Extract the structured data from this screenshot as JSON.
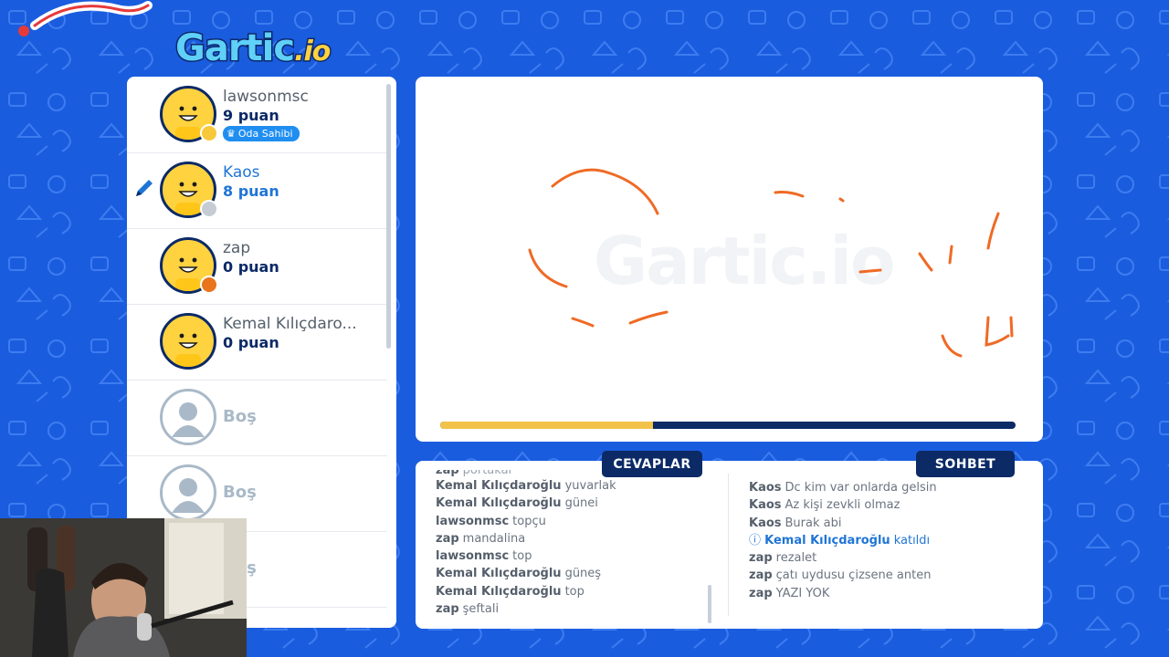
{
  "logo": {
    "text": "Gartic",
    "suffix": ".io"
  },
  "players": [
    {
      "name": "lawsonmsc",
      "score": "9 puan",
      "badge": "Oda Sahibi",
      "status_color": "#f7c83a",
      "active": false
    },
    {
      "name": "Kaos",
      "score": "8 puan",
      "status_color": "#c6ccd3",
      "active": true
    },
    {
      "name": "zap",
      "score": "0 puan",
      "status_color": "#e8741c",
      "active": false
    },
    {
      "name": "Kemal Kılıçdaro...",
      "score": "0 puan",
      "active": false
    },
    {
      "empty_label": "Boş"
    },
    {
      "empty_label": "Boş"
    },
    {
      "empty_label": "Boş"
    }
  ],
  "canvas": {
    "watermark": "Gartic.io",
    "stroke_color": "#ef6a25",
    "time_remaining_fraction": 0.37
  },
  "tabs": {
    "answers": "CEVAPLAR",
    "chat": "SOHBET"
  },
  "answers": [
    {
      "user": "zap",
      "text": "portakal",
      "partial": true
    },
    {
      "user": "Kemal Kılıçdaroğlu",
      "text": "yuvarlak"
    },
    {
      "user": "Kemal Kılıçdaroğlu",
      "text": "günei"
    },
    {
      "user": "lawsonmsc",
      "text": "topçu"
    },
    {
      "user": "zap",
      "text": "mandalina"
    },
    {
      "user": "lawsonmsc",
      "text": "top"
    },
    {
      "user": "Kemal Kılıçdaroğlu",
      "text": "güneş"
    },
    {
      "user": "Kemal Kılıçdaroğlu",
      "text": "top"
    },
    {
      "user": "zap",
      "text": "şeftali"
    }
  ],
  "chat": [
    {
      "user": "Kaos",
      "text": "Dc kim var onlarda gelsin"
    },
    {
      "user": "Kaos",
      "text": "Az kişi zevkli olmaz"
    },
    {
      "user": "Kaos",
      "text": "Burak abi"
    },
    {
      "user": "Kemal Kılıçdaroğlu",
      "text": "katıldı",
      "system": true
    },
    {
      "user": "zap",
      "text": "rezalet"
    },
    {
      "user": "zap",
      "text": "çatı uydusu çizsene anten"
    },
    {
      "user": "zap",
      "text": "YAZI YOK"
    }
  ],
  "colors": {
    "background": "#1a5cde",
    "navy": "#0b2a66",
    "accent_blue": "#1f75d6",
    "timer_yellow": "#f2c24b"
  }
}
